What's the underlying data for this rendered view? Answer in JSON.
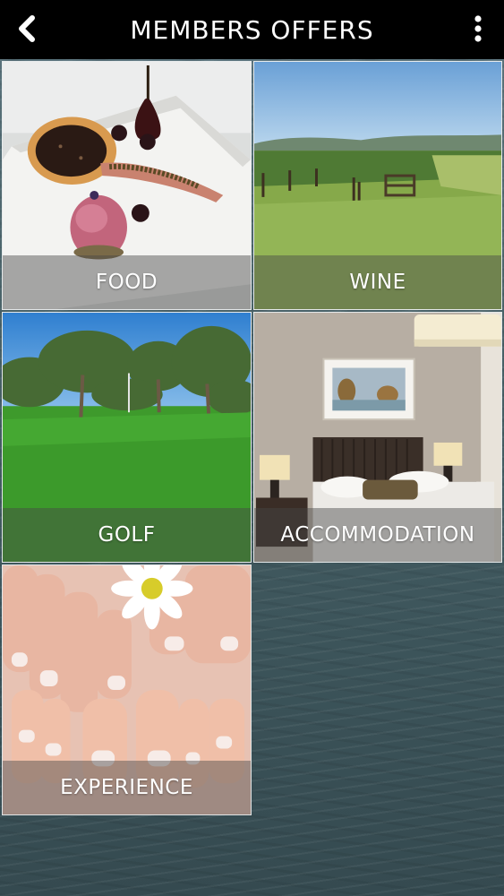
{
  "header": {
    "title": "MEMBERS OFFERS",
    "back_icon": "chevron-left-icon",
    "menu_icon": "vertical-ellipsis-icon"
  },
  "tiles": [
    {
      "label": "FOOD"
    },
    {
      "label": "WINE"
    },
    {
      "label": "GOLF"
    },
    {
      "label": "ACCOMMODATION"
    },
    {
      "label": "EXPERIENCE"
    }
  ],
  "colors": {
    "header_bg": "#000000",
    "header_text": "#ffffff",
    "label_text": "#ffffff",
    "background_water": "#496268"
  }
}
